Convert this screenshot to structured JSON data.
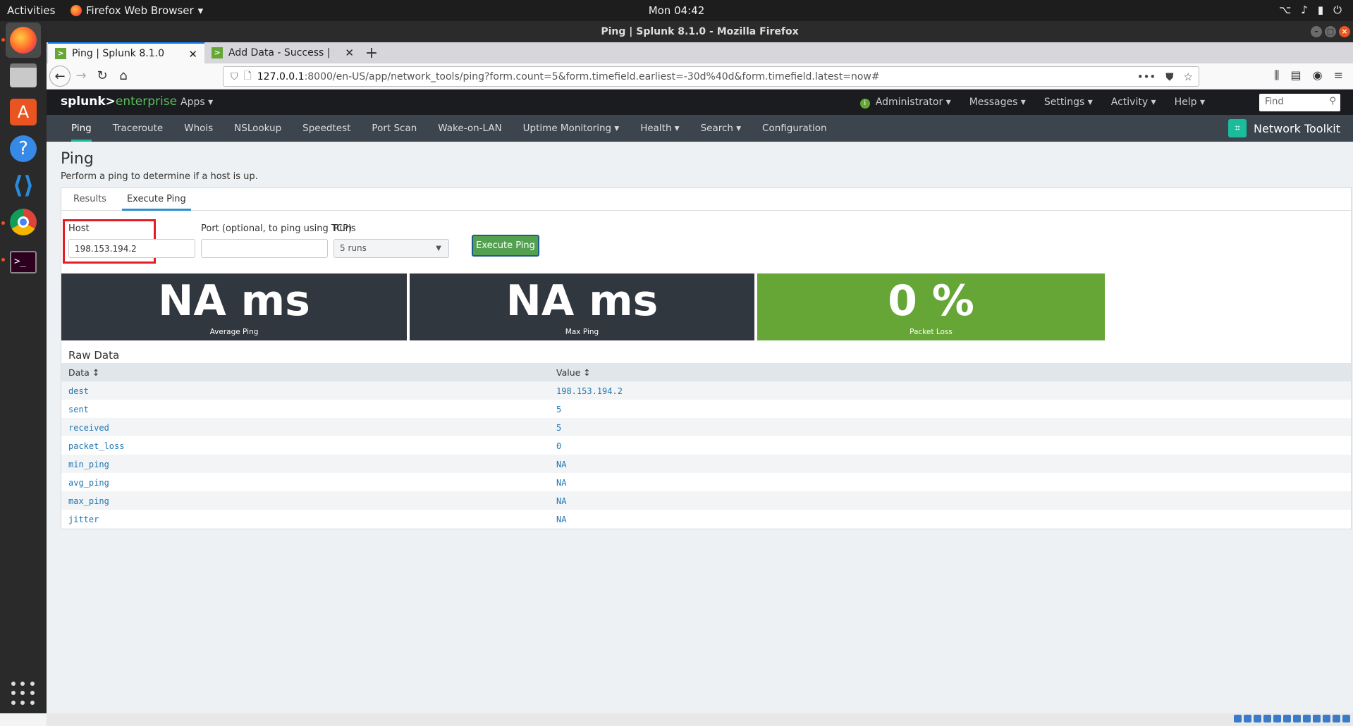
{
  "topbar": {
    "activities": "Activities",
    "app_menu": "Firefox Web Browser",
    "clock": "Mon 04:42"
  },
  "window": {
    "title": "Ping | Splunk 8.1.0 - Mozilla Firefox"
  },
  "browser": {
    "tabs": [
      {
        "label": "Ping | Splunk 8.1.0",
        "active": true
      },
      {
        "label": "Add Data - Success | Splu",
        "active": false
      }
    ],
    "url_host": "127.0.0.1",
    "url_rest": ":8000/en-US/app/network_tools/ping?form.count=5&form.timefield.earliest=-30d%40d&form.timefield.latest=now#"
  },
  "splunk": {
    "logo_main": "splunk>",
    "logo_sub": "enterprise",
    "apps": "Apps ▾",
    "menu": [
      "Administrator ▾",
      "Messages ▾",
      "Settings ▾",
      "Activity ▾",
      "Help ▾"
    ],
    "find_placeholder": "Find"
  },
  "appnav": {
    "items": [
      "Ping",
      "Traceroute",
      "Whois",
      "NSLookup",
      "Speedtest",
      "Port Scan",
      "Wake-on-LAN",
      "Uptime Monitoring ▾",
      "Health ▾",
      "Search ▾",
      "Configuration"
    ],
    "app_name": "Network Toolkit"
  },
  "page": {
    "title": "Ping",
    "description": "Perform a ping to determine if a host is up.",
    "tabs": [
      "Results",
      "Execute Ping"
    ]
  },
  "form": {
    "host_label": "Host",
    "host_value": "198.153.194.2",
    "port_label": "Port (optional, to ping using TCP)",
    "port_value": "",
    "runs_label": "Runs",
    "runs_value": "5 runs",
    "execute_label": "Execute Ping"
  },
  "singles": [
    {
      "value": "NA ms",
      "label": "Average Ping",
      "color": "#31373e"
    },
    {
      "value": "NA ms",
      "label": "Max Ping",
      "color": "#31373e"
    },
    {
      "value": "0 %",
      "label": "Packet Loss",
      "color": "#65a637"
    }
  ],
  "raw": {
    "title": "Raw Data",
    "col_data": "Data ↕",
    "col_value": "Value ↕",
    "rows": [
      {
        "data": "dest",
        "value": "198.153.194.2"
      },
      {
        "data": "sent",
        "value": "5"
      },
      {
        "data": "received",
        "value": "5"
      },
      {
        "data": "packet_loss",
        "value": "0"
      },
      {
        "data": "min_ping",
        "value": "NA"
      },
      {
        "data": "avg_ping",
        "value": "NA"
      },
      {
        "data": "max_ping",
        "value": "NA"
      },
      {
        "data": "jitter",
        "value": "NA"
      }
    ]
  }
}
